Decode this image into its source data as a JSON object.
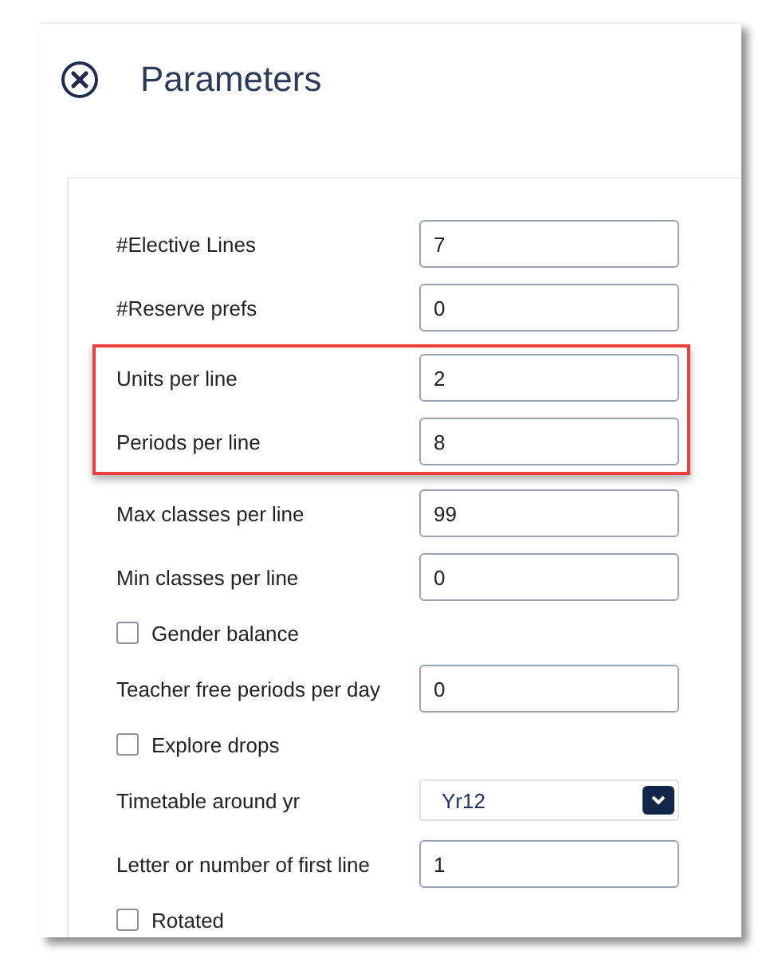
{
  "dialog": {
    "title": "Parameters"
  },
  "rows": [
    {
      "kind": "field",
      "label": "#Elective Lines",
      "value": "7",
      "highlighted": false
    },
    {
      "kind": "field",
      "label": "#Reserve prefs",
      "value": "0",
      "highlighted": false
    },
    {
      "kind": "field",
      "label": "Units per line",
      "value": "2",
      "highlighted": true
    },
    {
      "kind": "field",
      "label": "Periods per line",
      "value": "8",
      "highlighted": true
    },
    {
      "kind": "field",
      "label": "Max classes per line",
      "value": "99",
      "highlighted": false
    },
    {
      "kind": "field",
      "label": "Min classes per line",
      "value": "0",
      "highlighted": false
    },
    {
      "kind": "checkbox",
      "label": "Gender balance",
      "checked": false,
      "highlighted": false
    },
    {
      "kind": "field",
      "label": "Teacher free periods per day",
      "value": "0",
      "highlighted": false
    },
    {
      "kind": "checkbox",
      "label": "Explore drops",
      "checked": false,
      "highlighted": false
    },
    {
      "kind": "select",
      "label": "Timetable around yr",
      "value": "Yr12",
      "highlighted": false
    },
    {
      "kind": "field",
      "label": "Letter or number of first line",
      "value": "1",
      "highlighted": false
    },
    {
      "kind": "checkbox",
      "label": "Rotated",
      "checked": false,
      "highlighted": false
    }
  ]
}
